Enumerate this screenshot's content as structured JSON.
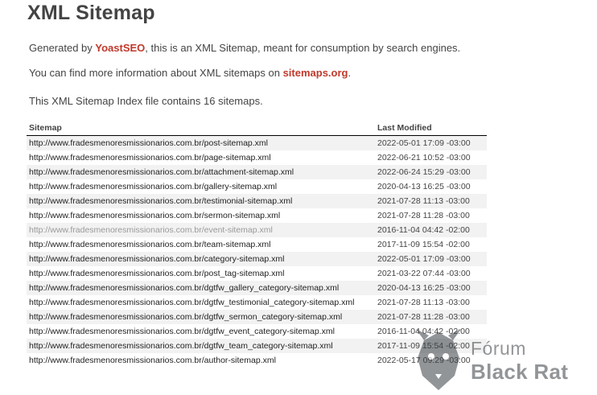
{
  "page": {
    "title": "XML Sitemap",
    "intro": {
      "generated_prefix": "Generated by ",
      "generated_link": "YoastSEO",
      "generated_suffix": ", this is an XML Sitemap, meant for consumption by search engines.",
      "info_prefix": "You can find more information about XML sitemaps on ",
      "info_link": "sitemaps.org",
      "info_suffix": ".",
      "count_text": "This XML Sitemap Index file contains 16 sitemaps."
    }
  },
  "table": {
    "headers": {
      "sitemap": "Sitemap",
      "last_modified": "Last Modified"
    },
    "rows": [
      {
        "url": "http://www.fradesmenoresmissionarios.com.br/post-sitemap.xml",
        "modified": "2022-05-01 17:09 -03:00"
      },
      {
        "url": "http://www.fradesmenoresmissionarios.com.br/page-sitemap.xml",
        "modified": "2022-06-21 10:52 -03:00"
      },
      {
        "url": "http://www.fradesmenoresmissionarios.com.br/attachment-sitemap.xml",
        "modified": "2022-06-24 15:29 -03:00"
      },
      {
        "url": "http://www.fradesmenoresmissionarios.com.br/gallery-sitemap.xml",
        "modified": "2020-04-13 16:25 -03:00"
      },
      {
        "url": "http://www.fradesmenoresmissionarios.com.br/testimonial-sitemap.xml",
        "modified": "2021-07-28 11:13 -03:00"
      },
      {
        "url": "http://www.fradesmenoresmissionarios.com.br/sermon-sitemap.xml",
        "modified": "2021-07-28 11:28 -03:00"
      },
      {
        "url": "http://www.fradesmenoresmissionarios.com.br/event-sitemap.xml",
        "modified": "2016-11-04 04:42 -02:00"
      },
      {
        "url": "http://www.fradesmenoresmissionarios.com.br/team-sitemap.xml",
        "modified": "2017-11-09 15:54 -02:00"
      },
      {
        "url": "http://www.fradesmenoresmissionarios.com.br/category-sitemap.xml",
        "modified": "2022-05-01 17:09 -03:00"
      },
      {
        "url": "http://www.fradesmenoresmissionarios.com.br/post_tag-sitemap.xml",
        "modified": "2021-03-22 07:44 -03:00"
      },
      {
        "url": "http://www.fradesmenoresmissionarios.com.br/dgtfw_gallery_category-sitemap.xml",
        "modified": "2020-04-13 16:25 -03:00"
      },
      {
        "url": "http://www.fradesmenoresmissionarios.com.br/dgtfw_testimonial_category-sitemap.xml",
        "modified": "2021-07-28 11:13 -03:00"
      },
      {
        "url": "http://www.fradesmenoresmissionarios.com.br/dgtfw_sermon_category-sitemap.xml",
        "modified": "2021-07-28 11:28 -03:00"
      },
      {
        "url": "http://www.fradesmenoresmissionarios.com.br/dgtfw_event_category-sitemap.xml",
        "modified": "2016-11-04 04:42 -02:00"
      },
      {
        "url": "http://www.fradesmenoresmissionarios.com.br/dgtfw_team_category-sitemap.xml",
        "modified": "2017-11-09 15:54 -02:00"
      },
      {
        "url": "http://www.fradesmenoresmissionarios.com.br/author-sitemap.xml",
        "modified": "2022-05-17 09:29 -03:00"
      }
    ]
  },
  "watermark": {
    "line1": "Fórum",
    "line2": "Black Rat",
    "logo_icon": "rat-head-icon"
  },
  "colors": {
    "link": "#c0392b",
    "text": "#444444",
    "row_stripe": "#f2f2f2",
    "dim_row": "#9a9a9a"
  }
}
